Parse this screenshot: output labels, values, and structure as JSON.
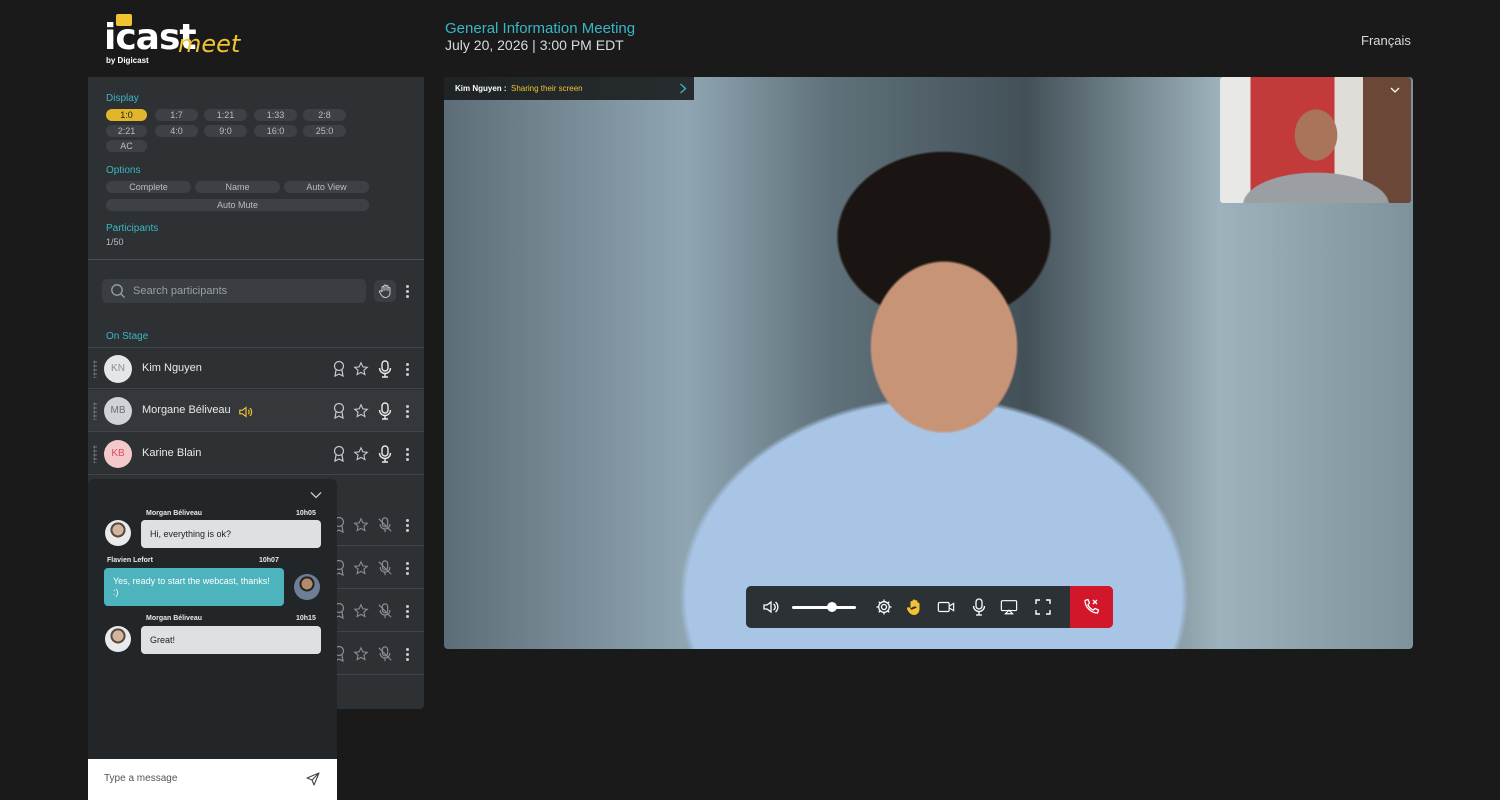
{
  "brand": {
    "name": "icast",
    "product": "meet",
    "by": "by Digicast"
  },
  "header": {
    "meeting_title": "General Information Meeting",
    "meeting_date": "July 20, 2026 | 3:00 PM EDT",
    "language": "Français"
  },
  "settings": {
    "display_label": "Display",
    "display_options": [
      "1:0",
      "1:7",
      "1:21",
      "1:33",
      "2:8",
      "2:21",
      "4:0",
      "9:0",
      "16:0",
      "25:0",
      "AC"
    ],
    "display_selected": "1:0",
    "options_label": "Options",
    "options": [
      "Complete",
      "Name",
      "Auto View",
      "Auto Mute"
    ],
    "participants_label": "Participants",
    "participants_count": "1/50"
  },
  "search": {
    "placeholder": "Search participants"
  },
  "stage": {
    "label": "On Stage",
    "participants": [
      {
        "initials": "KN",
        "name": "Kim Nguyen",
        "speaking": false,
        "avatar_bg": "#e4e6e8",
        "avatar_fg": "#8a8e93"
      },
      {
        "initials": "MB",
        "name": "Morgane Béliveau",
        "speaking": true,
        "avatar_bg": "#cfd3d8",
        "avatar_fg": "#6a6e74"
      },
      {
        "initials": "KB",
        "name": "Karine Blain",
        "speaking": false,
        "avatar_bg": "#f3c9cc",
        "avatar_fg": "#d9515c"
      }
    ]
  },
  "chat": {
    "messages": [
      {
        "author": "Morgan Béliveau",
        "time": "10h05",
        "text": "Hi, everything is ok?",
        "direction": "in"
      },
      {
        "author": "Flavien Lefort",
        "time": "10h07",
        "text": "Yes, ready to start the webcast, thanks! :)",
        "direction": "out"
      },
      {
        "author": "Morgan Béliveau",
        "time": "10h15",
        "text": "Great!",
        "direction": "in"
      }
    ],
    "input_placeholder": "Type a message"
  },
  "video": {
    "sharing_user": "Kim Nguyen :",
    "sharing_status": "Sharing their screen",
    "volume": 0.62
  },
  "colors": {
    "accent": "#3ab6c6",
    "brand_yellow": "#f2c230",
    "hangup": "#d3172b"
  }
}
